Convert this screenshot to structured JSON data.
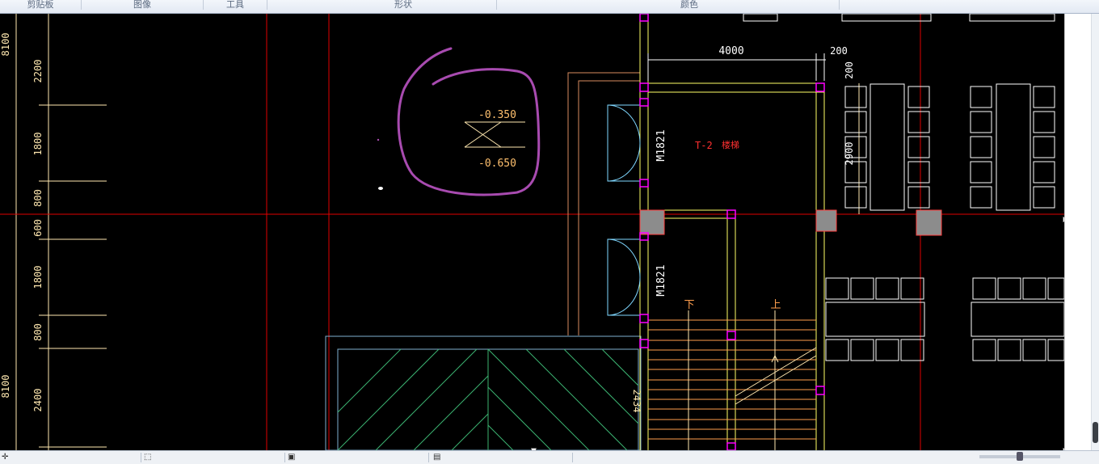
{
  "ribbon": {
    "groups": [
      {
        "label": "剪贴板"
      },
      {
        "label": "图像"
      },
      {
        "label": "工具"
      },
      {
        "label": "形状"
      },
      {
        "label": "颜色"
      }
    ]
  },
  "drawing": {
    "left_dims": [
      "2200",
      "1800",
      "800",
      "600",
      "1800",
      "800",
      "2400"
    ],
    "left_side_labels": [
      "8100",
      "8100"
    ],
    "elevation_top": "-0.350",
    "elevation_bottom": "-0.650",
    "dim_4000": "4000",
    "dim_200_top": "200",
    "dim_200_side": "200",
    "dim_2900": "2900",
    "door_label_1": "M1821",
    "door_label_2": "M1821",
    "stair_label": "T-2",
    "stair_name": "楼梯",
    "stair_down": "下",
    "stair_up": "上",
    "wall_label": "2434",
    "colors": {
      "background": "#000000",
      "axis": "#e00000",
      "wall": "#ffff66",
      "dimension": "#ffe8b0",
      "door": "#7fd7ff",
      "column": "#8c8c8c",
      "annotation": "#a84bb0",
      "stair": "#ff9e4d",
      "hatch": "#3cb371",
      "magenta": "#ff00ff"
    }
  },
  "statusbar": {
    "segments": [
      "",
      "",
      "",
      ""
    ],
    "icons": [
      "cursor-position-icon",
      "selection-size-icon",
      "image-size-icon",
      "zoom-icon"
    ]
  }
}
